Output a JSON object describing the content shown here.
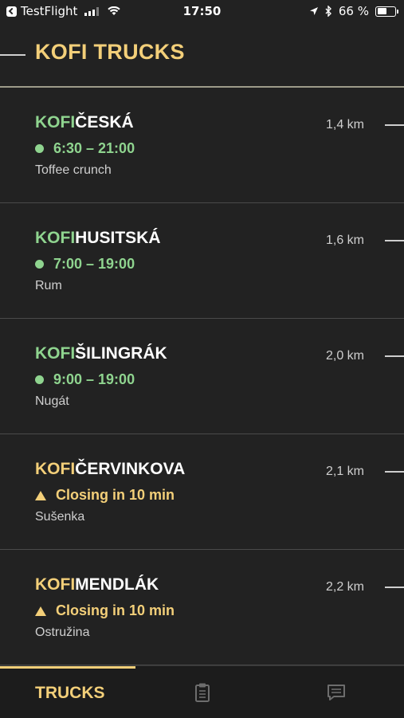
{
  "status_bar": {
    "back_app": "TestFlight",
    "time": "17:50",
    "battery": "66 %",
    "battery_level": 0.66
  },
  "header": {
    "title": "KOFI TRUCKS"
  },
  "trucks": [
    {
      "brand": "KOFI",
      "name": "ČESKÁ",
      "status_type": "open",
      "status": "6:30 – 21:00",
      "flavor": "Toffee crunch",
      "distance": "1,4 km"
    },
    {
      "brand": "KOFI",
      "name": "HUSITSKÁ",
      "status_type": "open",
      "status": "7:00 – 19:00",
      "flavor": "Rum",
      "distance": "1,6 km"
    },
    {
      "brand": "KOFI",
      "name": "ŠILINGRÁK",
      "status_type": "open",
      "status": "9:00 – 19:00",
      "flavor": "Nugát",
      "distance": "2,0 km"
    },
    {
      "brand": "KOFI",
      "name": "ČERVINKOVA",
      "status_type": "closing",
      "status": "Closing in 10 min",
      "flavor": "Sušenka",
      "distance": "2,1 km"
    },
    {
      "brand": "KOFI",
      "name": "MENDLÁK",
      "status_type": "closing",
      "status": "Closing in 10 min",
      "flavor": "Ostružina",
      "distance": "2,2 km"
    }
  ],
  "tabbar": {
    "active_label": "TRUCKS",
    "icons": [
      "clipboard-icon",
      "chat-icon"
    ]
  },
  "colors": {
    "background": "#222222",
    "accent_yellow": "#f3cf79",
    "open_green": "#8fd48f"
  }
}
